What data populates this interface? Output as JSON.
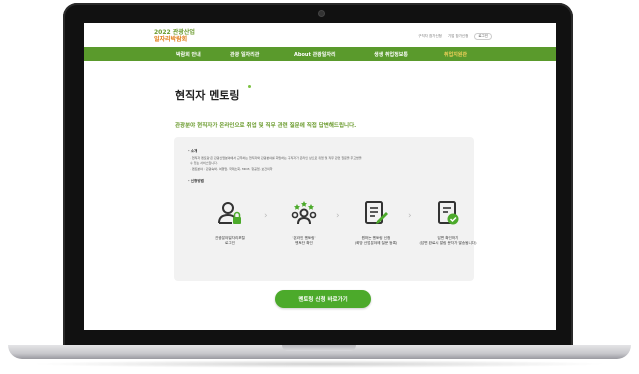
{
  "header": {
    "logo_line1": "2022 관광산업",
    "logo_line2": "일자리박람회",
    "util_links": [
      "구직자 참가신청",
      "기업 참가신청",
      "로그인"
    ]
  },
  "nav": {
    "items": [
      "박람회 안내",
      "관광 일자리관",
      "About 관광일자리",
      "생생 취업정보통",
      "취업지원관"
    ],
    "active_index": 4
  },
  "main": {
    "title": "현직자 멘토링",
    "subtitle": "관광분야 현직자가 온라인으로 취업 및 직무 관련 질문에 직접 답변해드립니다.",
    "intro_heading": "- 소개",
    "intro_lines": [
      "· 현직자 멘토링'은 관광산업분야에서 근무하는 현직자와 관광분야를 희망하는 구직자가 온라인 상으로 취업 및 직무 관련 질문을 주고받을",
      "  수 있는 서비스입니다.",
      "· 멘토분야 : 관광숙박, 여행업, 국제소회, MICE, 항공업, 보건의학"
    ],
    "method_heading": "- 신청방법",
    "steps": [
      {
        "label_1": "관광분야일자리포털",
        "label_2": "로그인",
        "icon": "user-lock-icon"
      },
      {
        "label_1": "'온라인 멘토링'",
        "label_2": "멘토단 확인",
        "icon": "mentor-group-icon"
      },
      {
        "label_1": "원하는 멘토링 신청",
        "label_2": "(희망 산업분야에 질문 등록)",
        "icon": "edit-document-icon"
      },
      {
        "label_1": "답변 확인하기",
        "label_2": "(답변 완료시 알림 문자가 발송됩니다)",
        "icon": "check-document-icon"
      }
    ],
    "cta_label": "멘토링 신청 바로가기"
  },
  "colors": {
    "nav_green": "#5a9a2c",
    "accent_green": "#6b9b2e",
    "active_nav": "#f3d25a",
    "cta": "#4caa2b"
  }
}
